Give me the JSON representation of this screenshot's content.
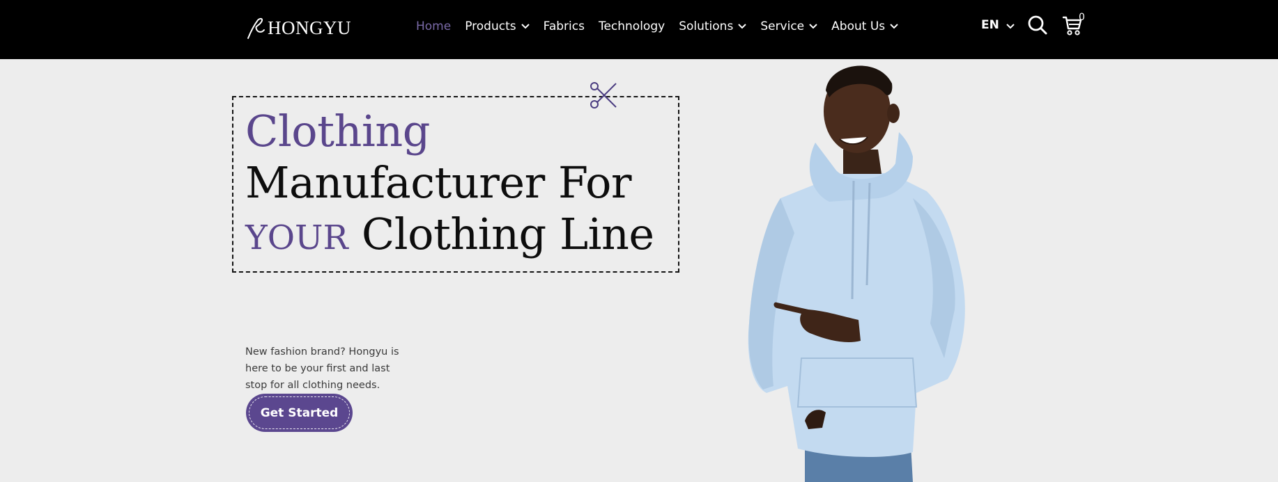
{
  "brand": {
    "name": "HONGYU"
  },
  "nav": {
    "items": [
      {
        "label": "Home",
        "active": true,
        "dropdown": false
      },
      {
        "label": "Products",
        "active": false,
        "dropdown": true
      },
      {
        "label": "Fabrics",
        "active": false,
        "dropdown": false
      },
      {
        "label": "Technology",
        "active": false,
        "dropdown": false
      },
      {
        "label": "Solutions",
        "active": false,
        "dropdown": true
      },
      {
        "label": "Service",
        "active": false,
        "dropdown": true
      },
      {
        "label": "About Us",
        "active": false,
        "dropdown": true
      }
    ],
    "language": "EN",
    "cart_count": "0",
    "icons": [
      "search-icon",
      "cart-icon",
      "chevron-down-icon"
    ]
  },
  "hero": {
    "line1": "Clothing",
    "line2": "Manufacturer For",
    "line3_accent": "YOUR",
    "line3_rest": "Clothing Line",
    "description": "New fashion brand? Hongyu is here to be your first and last stop for all clothing needs.",
    "cta_label": "Get Started"
  },
  "colors": {
    "header_bg": "#000000",
    "page_bg": "#ededed",
    "accent": "#5b478f",
    "active_nav": "#7a6aa8"
  }
}
